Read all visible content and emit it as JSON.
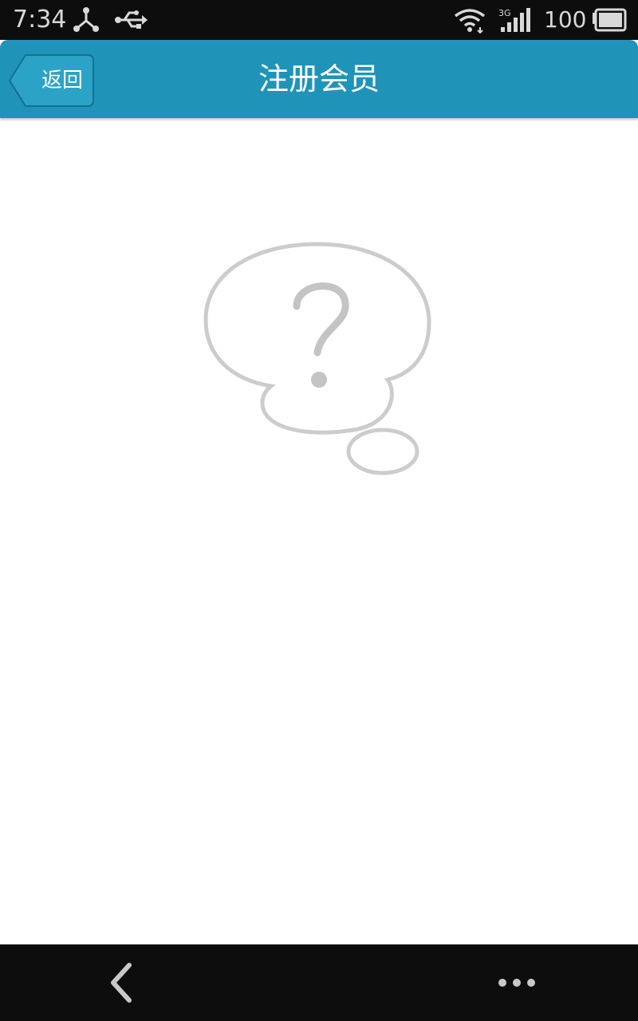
{
  "status_bar": {
    "time": "7:34",
    "battery_level": "100",
    "icons": [
      "network-share-icon",
      "usb-icon",
      "wifi-icon",
      "signal-3g-icon",
      "battery-icon"
    ],
    "network_type": "3G"
  },
  "header": {
    "back_label": "返回",
    "title": "注册会员"
  },
  "empty_state": {
    "icon": "question-thought-bubble-icon"
  },
  "nav_bar": {
    "icons": [
      "nav-back-icon",
      "nav-menu-icon"
    ]
  },
  "colors": {
    "header_bg": "#1f94b8",
    "status_bar_bg": "#0d0d0d",
    "icon_gray": "#cccccc"
  }
}
